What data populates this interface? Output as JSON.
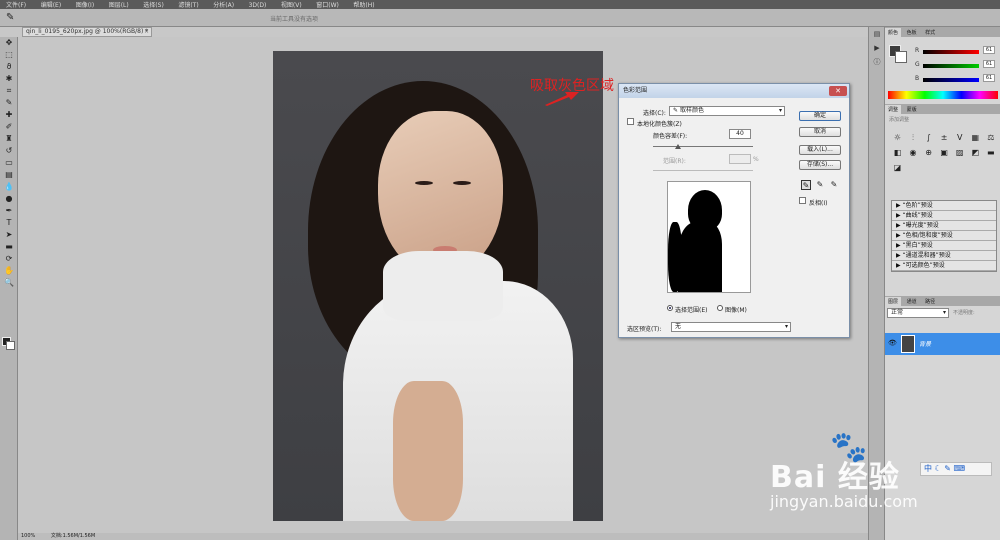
{
  "menubar": {
    "items": [
      "文件(F)",
      "编辑(E)",
      "图像(I)",
      "图层(L)",
      "选择(S)",
      "滤镜(T)",
      "分析(A)",
      "3D(D)",
      "视图(V)",
      "窗口(W)",
      "帮助(H)"
    ]
  },
  "options_bar": {
    "hint": "当前工具没有选项"
  },
  "document": {
    "tab_title": "qin_li_0195_620px.jpg @ 100%(RGB/8) *",
    "close_glyph": "×"
  },
  "annotation": {
    "text": "吸取灰色区域",
    "color": "#dd2222"
  },
  "dialog": {
    "title": "色彩范围",
    "select_label": "选择(C):",
    "select_value": "取样颜色",
    "localized_label": "本地化颜色簇(Z)",
    "fuzziness_label": "颜色容差(F):",
    "fuzziness_value": "40",
    "range_label": "范围(R):",
    "range_unit": "%",
    "ok_label": "确定",
    "cancel_label": "取消",
    "load_label": "载入(L)...",
    "save_label": "存储(S)...",
    "invert_label": "反相(I)",
    "radio_selection_label": "选择范围(E)",
    "radio_image_label": "图像(M)",
    "preview_label": "选区预览(T):",
    "preview_value": "无"
  },
  "panels": {
    "color_tabs": [
      "颜色",
      "色板",
      "样式"
    ],
    "rgb": [
      {
        "channel": "R",
        "value": "61",
        "color": "#d33"
      },
      {
        "channel": "G",
        "value": "61",
        "color": "#3a3"
      },
      {
        "channel": "B",
        "value": "61",
        "color": "#33d"
      }
    ],
    "adjust_tabs": [
      "调整",
      "蒙版"
    ],
    "adjust_hint": "添加调整",
    "presets": [
      "“色阶”预设",
      "“曲线”预设",
      "“曝光度”预设",
      "“色相/饱和度”预设",
      "“黑白”预设",
      "“通道混和器”预设",
      "“可选颜色”预设"
    ],
    "layer_tabs": [
      "图层",
      "通道",
      "路径"
    ],
    "blend_mode": "正常",
    "opacity_label": "不透明度:",
    "layer_name": "背景"
  },
  "statusbar": {
    "zoom": "100%",
    "doc_info": "文档:1.56M/1.56M"
  },
  "watermark": {
    "main": "Bai 经验",
    "url": "jingyan.baidu.com"
  },
  "ime": {
    "text": "中"
  }
}
